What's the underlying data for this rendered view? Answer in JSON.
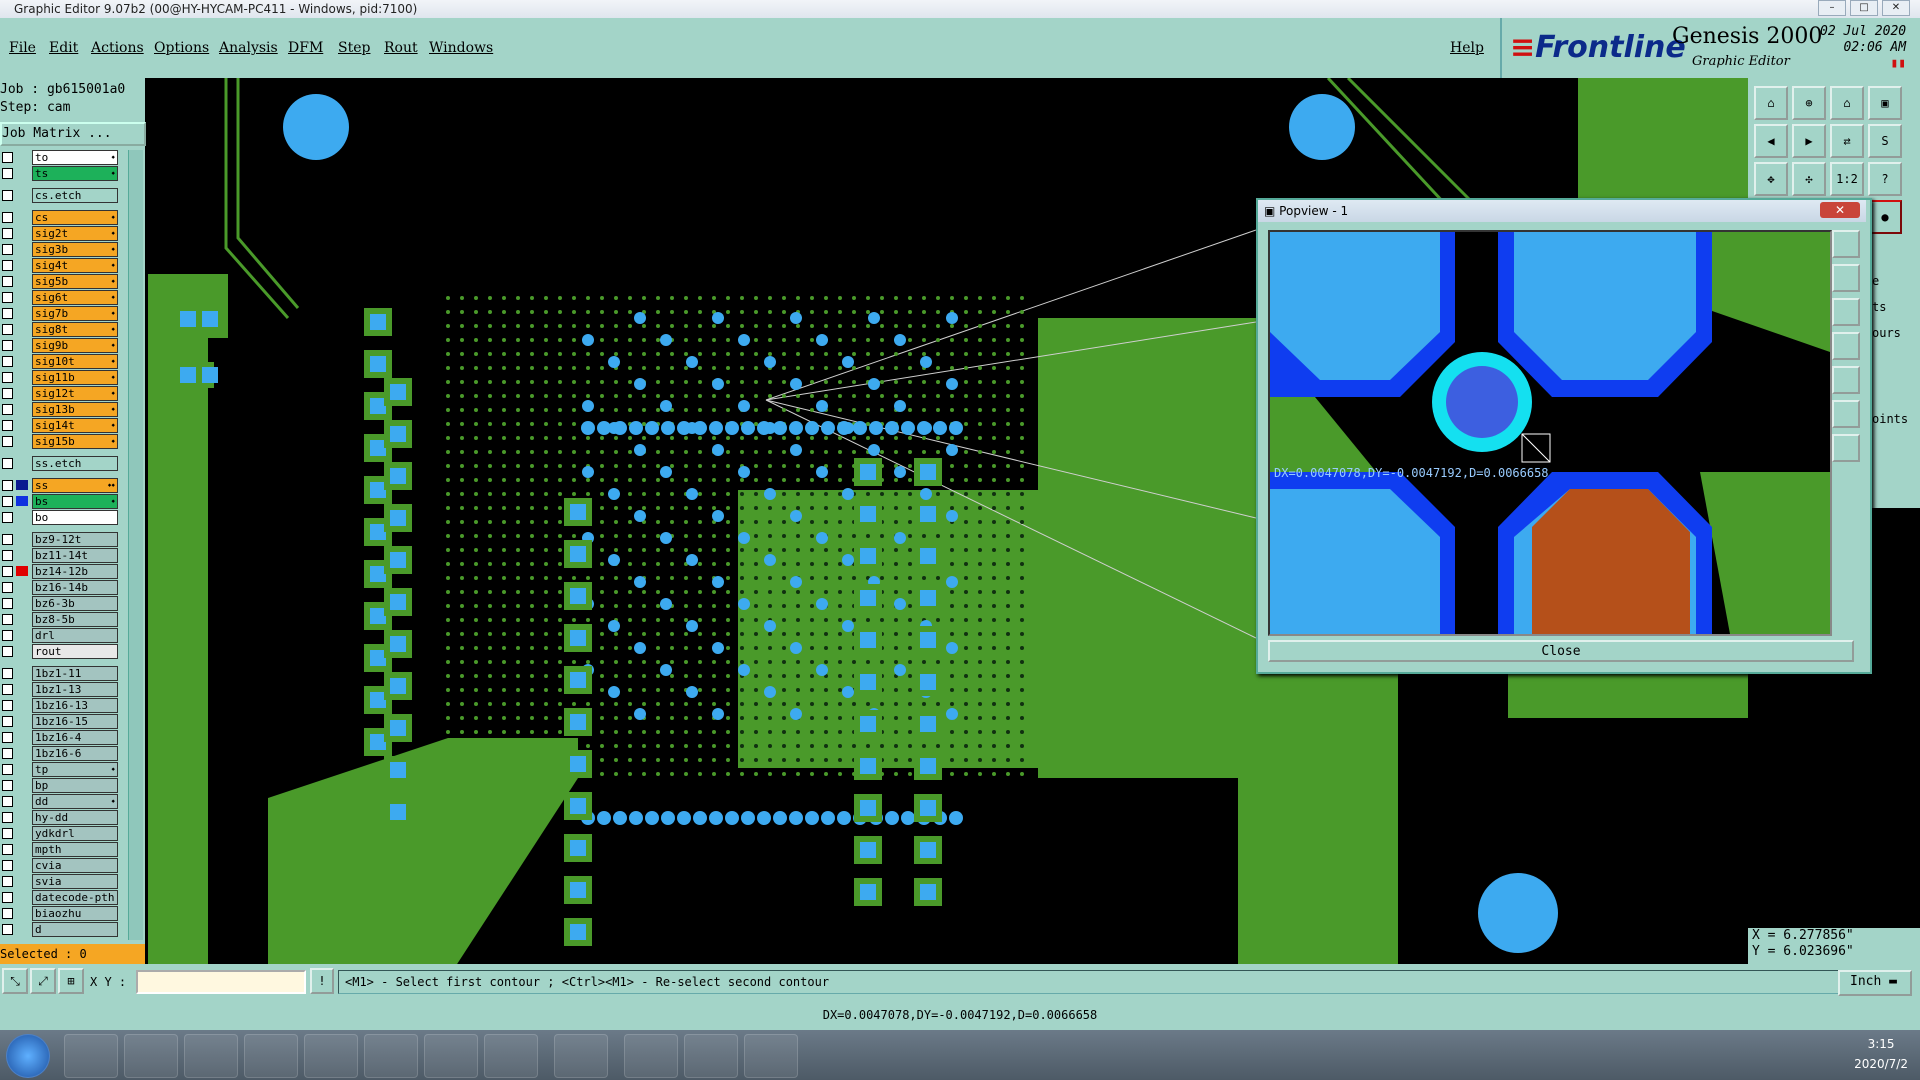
{
  "window": {
    "title": "Graphic Editor 9.07b2 (00@HY-HYCAM-PC411 - Windows, pid:7100)"
  },
  "menu": {
    "items": [
      "File",
      "Edit",
      "Actions",
      "Options",
      "Analysis",
      "DFM",
      "Step",
      "Rout",
      "Windows"
    ],
    "help": "Help"
  },
  "brand": {
    "logo": "Frontline",
    "product": "Genesis 2000",
    "subtitle": "Graphic Editor",
    "date": "02 Jul 2020",
    "time": "02:06 AM"
  },
  "left_panel": {
    "job": "Job : gb615001a0",
    "step": "Step: cam",
    "job_matrix": "Job Matrix ...",
    "layers": [
      {
        "name": "to",
        "color": "#ffffff",
        "mark": "⬩"
      },
      {
        "name": "ts",
        "color": "#1db15a",
        "mark": "⬩"
      },
      {
        "name": "cs.etch",
        "color": "#a3d4c8",
        "mark": ""
      },
      {
        "name": "cs",
        "color": "#f5a623",
        "mark": "⬩"
      },
      {
        "name": "sig2t",
        "color": "#f5a623",
        "mark": "⬩"
      },
      {
        "name": "sig3b",
        "color": "#f5a623",
        "mark": "⬩"
      },
      {
        "name": "sig4t",
        "color": "#f5a623",
        "mark": "⬩"
      },
      {
        "name": "sig5b",
        "color": "#f5a623",
        "mark": "⬩"
      },
      {
        "name": "sig6t",
        "color": "#f5a623",
        "mark": "⬩"
      },
      {
        "name": "sig7b",
        "color": "#f5a623",
        "mark": "⬩"
      },
      {
        "name": "sig8t",
        "color": "#f5a623",
        "mark": "⬩"
      },
      {
        "name": "sig9b",
        "color": "#f5a623",
        "mark": "⬩"
      },
      {
        "name": "sig10t",
        "color": "#f5a623",
        "mark": "⬩"
      },
      {
        "name": "sig11b",
        "color": "#f5a623",
        "mark": "⬩"
      },
      {
        "name": "sig12t",
        "color": "#f5a623",
        "mark": "⬩"
      },
      {
        "name": "sig13b",
        "color": "#f5a623",
        "mark": "⬩"
      },
      {
        "name": "sig14t",
        "color": "#f5a623",
        "mark": "⬩"
      },
      {
        "name": "sig15b",
        "color": "#f5a623",
        "mark": "⬩"
      },
      {
        "name": "ss.etch",
        "color": "#a3d4c8",
        "mark": ""
      },
      {
        "name": "ss",
        "color": "#f5a623",
        "mark": "⬩⬩"
      },
      {
        "name": "bs",
        "color": "#1db15a",
        "mark": "⬩"
      },
      {
        "name": "bo",
        "color": "#ffffff",
        "mark": ""
      },
      {
        "name": "bz9-12t",
        "color": "#a3c4c0",
        "mark": ""
      },
      {
        "name": "bz11-14t",
        "color": "#a3c4c0",
        "mark": ""
      },
      {
        "name": "bz14-12b",
        "color": "#a3c4c0",
        "mark": ""
      },
      {
        "name": "bz16-14b",
        "color": "#a3c4c0",
        "mark": ""
      },
      {
        "name": "bz6-3b",
        "color": "#a3c4c0",
        "mark": ""
      },
      {
        "name": "bz8-5b",
        "color": "#a3c4c0",
        "mark": ""
      },
      {
        "name": "drl",
        "color": "#a3c4c0",
        "mark": ""
      },
      {
        "name": "rout",
        "color": "#e8e8e8",
        "mark": ""
      },
      {
        "name": "1bz1-11",
        "color": "#a3c4c0",
        "mark": ""
      },
      {
        "name": "1bz1-13",
        "color": "#a3c4c0",
        "mark": ""
      },
      {
        "name": "1bz16-13",
        "color": "#a3c4c0",
        "mark": ""
      },
      {
        "name": "1bz16-15",
        "color": "#a3c4c0",
        "mark": ""
      },
      {
        "name": "1bz16-4",
        "color": "#a3c4c0",
        "mark": ""
      },
      {
        "name": "1bz16-6",
        "color": "#a3c4c0",
        "mark": ""
      },
      {
        "name": "tp",
        "color": "#a3c4c0",
        "mark": "⬩"
      },
      {
        "name": "bp",
        "color": "#a3c4c0",
        "mark": ""
      },
      {
        "name": "dd",
        "color": "#a3c4c0",
        "mark": "⬩"
      },
      {
        "name": "hy-dd",
        "color": "#a3c4c0",
        "mark": ""
      },
      {
        "name": "ydkdrl",
        "color": "#a3c4c0",
        "mark": ""
      },
      {
        "name": "mpth",
        "color": "#a3c4c0",
        "mark": ""
      },
      {
        "name": "cvia",
        "color": "#a3c4c0",
        "mark": ""
      },
      {
        "name": "svia",
        "color": "#a3c4c0",
        "mark": ""
      },
      {
        "name": "datecode-pth",
        "color": "#a3c4c0",
        "mark": ""
      },
      {
        "name": "biaozhu",
        "color": "#a3c4c0",
        "mark": ""
      },
      {
        "name": "d",
        "color": "#a3c4c0",
        "mark": ""
      }
    ],
    "selected": "Selected : 0"
  },
  "right_panel": {
    "partial_labels": [
      "e",
      "ts",
      "ours",
      "oints"
    ],
    "coord_x": "X = 6.277856\"",
    "coord_y": "Y = 6.023696\""
  },
  "popview": {
    "title": "Popview - 1",
    "measure": "DX=0.0047078,DY=-0.0047192,D=0.0066658",
    "close": "Close"
  },
  "command": {
    "xy_label": "X Y :",
    "xy_value": "",
    "prompt": "<M1> - Select first contour ; <Ctrl><M1> - Re-select second contour",
    "units": "Inch"
  },
  "status": {
    "text": "DX=0.0047078,DY=-0.0047192,D=0.0066658"
  },
  "taskbar": {
    "time": "3:15",
    "date": "2020/7/2"
  },
  "colors": {
    "panel": "#a3d4c8",
    "copper": "#4a9a2a",
    "pad": "#3daaf0",
    "accent_orange": "#f5a623"
  }
}
